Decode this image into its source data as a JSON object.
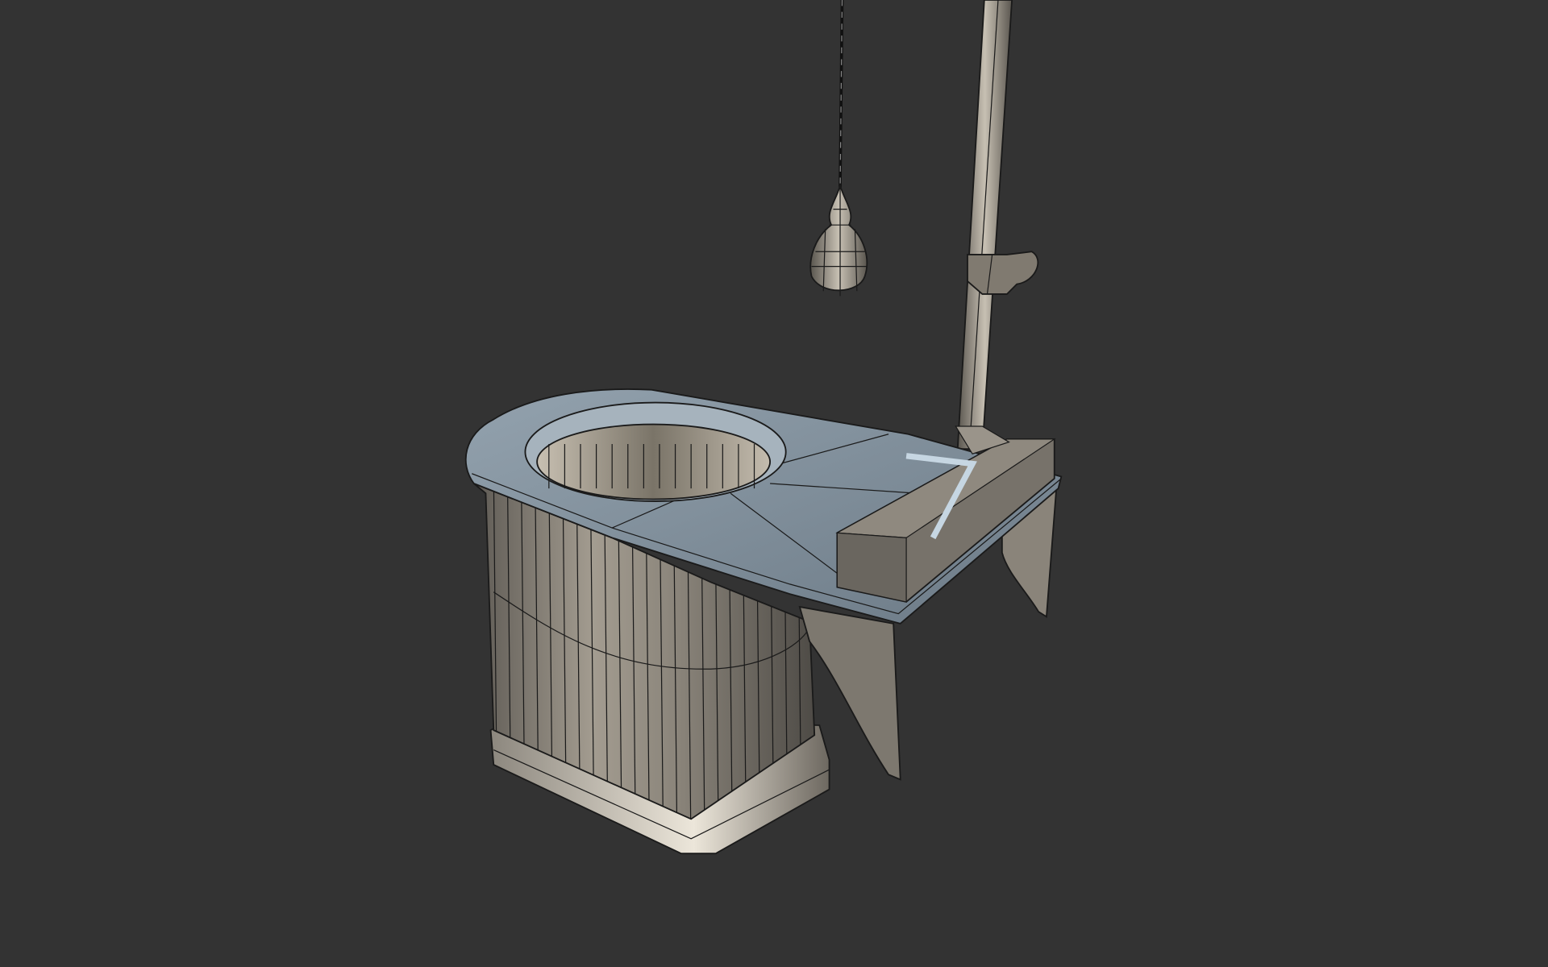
{
  "scene": {
    "background": "#333333",
    "model_top_color": "#7f8d99",
    "model_body_color": "#8f8a80",
    "edge_color": "#1a1a1a"
  }
}
